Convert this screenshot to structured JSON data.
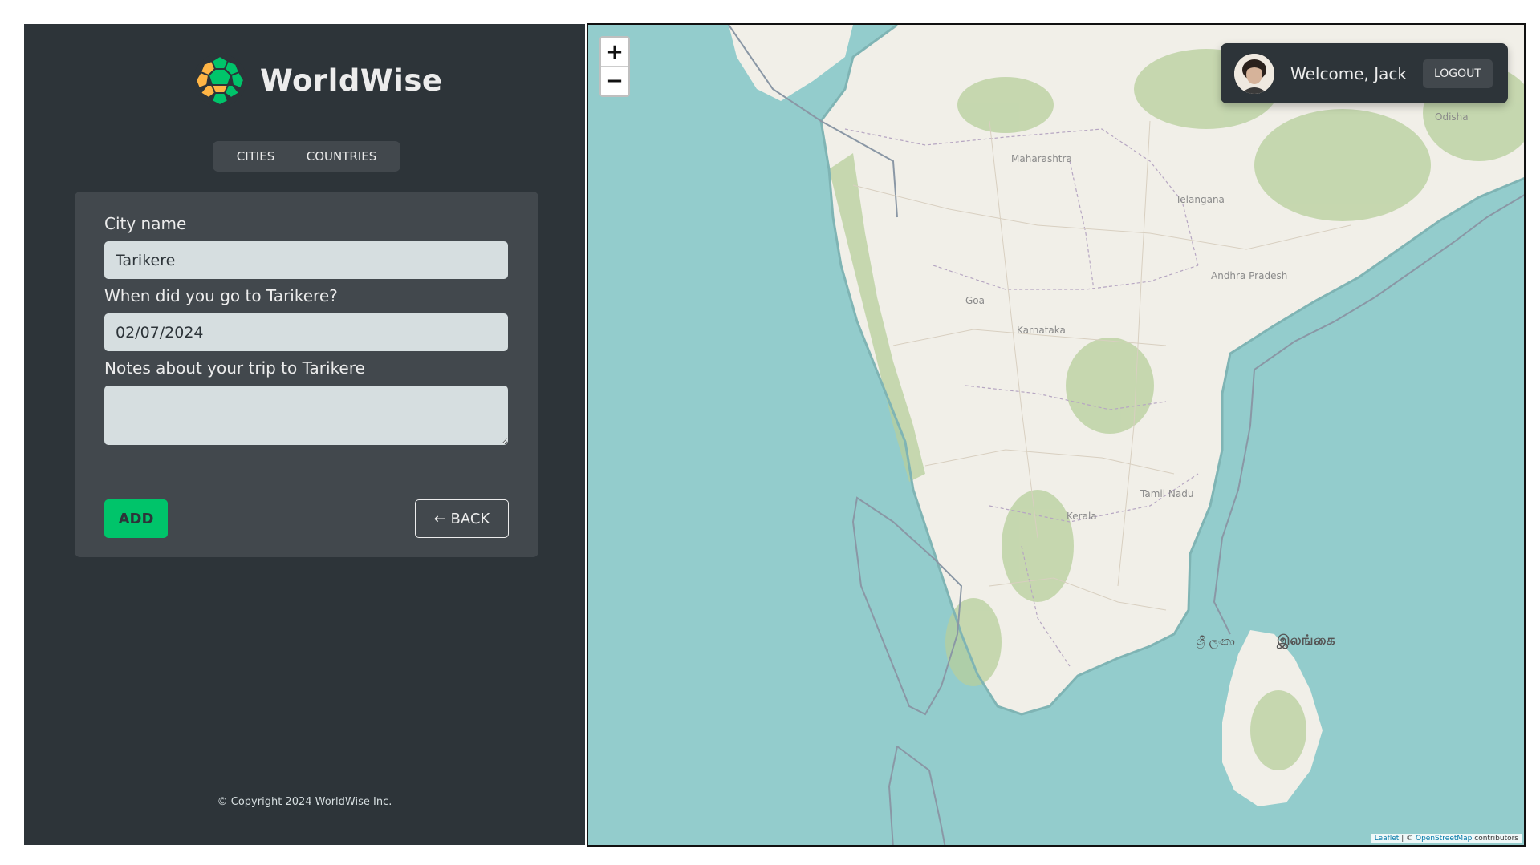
{
  "app": {
    "name": "WorldWise",
    "brand_colors": {
      "orange": "#ffb545",
      "green": "#00c46a",
      "dark": "#2d3439"
    }
  },
  "tabs": [
    {
      "label": "CITIES"
    },
    {
      "label": "COUNTRIES"
    }
  ],
  "form": {
    "city_label": "City name",
    "city_value": "Tarikere",
    "date_label": "When did you go to Tarikere?",
    "date_value": "02/07/2024",
    "notes_label": "Notes about your trip to Tarikere",
    "notes_value": "",
    "add_label": "ADD",
    "back_label": "← BACK"
  },
  "footer": {
    "copyright": "© Copyright 2024 WorldWise Inc."
  },
  "map": {
    "zoom_in": "+",
    "zoom_out": "−",
    "labels": {
      "maharashtra": "Maharashtra",
      "telangana": "Telangana",
      "andhra": "Andhra Pradesh",
      "goa": "Goa",
      "karnataka": "Karnataka",
      "tamil": "Tamil Nadu",
      "kerala": "Kerala",
      "odisha": "Odisha",
      "srilanka_si": "ශ්‍රී ලංකා",
      "srilanka_ta": "இலங்கை"
    },
    "attribution": {
      "leaflet": "Leaflet",
      "sep": "| ©",
      "osm": "OpenStreetMap",
      "contrib": "contributors"
    }
  },
  "user": {
    "welcome": "Welcome, Jack",
    "logout_label": "LOGOUT"
  }
}
